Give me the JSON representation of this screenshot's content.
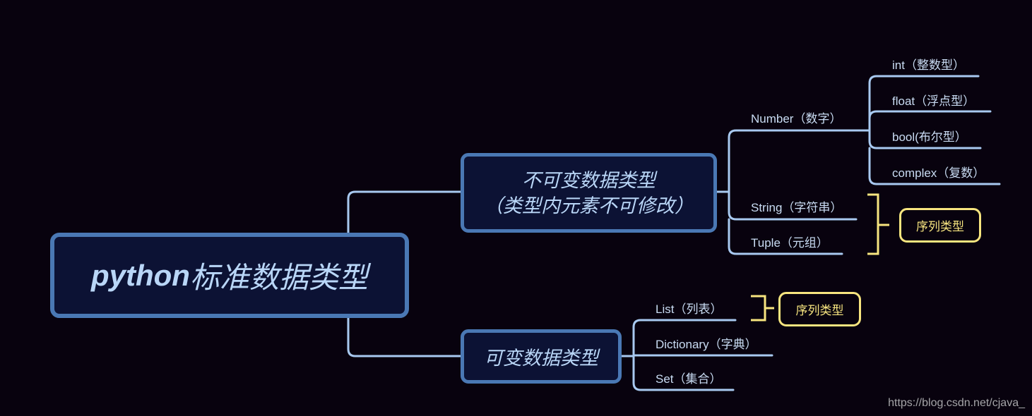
{
  "colors": {
    "background": "#08020e",
    "node_fill": "#0c1234",
    "node_border": "#4a78b4",
    "node_text": "#b9d6f7",
    "connector": "#a8c9f0",
    "bracket": "#f7e57f",
    "watermark": "#a5a5a8"
  },
  "root": {
    "label_en": "python",
    "label_zh": "标准数据类型"
  },
  "immutable": {
    "line1": "不可变数据类型",
    "line2": "（类型内元素不可修改）",
    "children": {
      "number": {
        "label": "Number（数字）",
        "children": [
          {
            "label": "int（整数型）"
          },
          {
            "label": "float（浮点型）"
          },
          {
            "label": "bool(布尔型）"
          },
          {
            "label": "complex（复数）"
          }
        ]
      },
      "string": {
        "label": "String（字符串）"
      },
      "tuple": {
        "label": "Tuple（元组）"
      }
    },
    "sequence_badge": "序列类型"
  },
  "mutable": {
    "label": "可变数据类型",
    "children": [
      {
        "label": "List（列表）"
      },
      {
        "label": "Dictionary（字典）"
      },
      {
        "label": "Set（集合）"
      }
    ],
    "sequence_badge": "序列类型"
  },
  "watermark": "https://blog.csdn.net/cjava_"
}
